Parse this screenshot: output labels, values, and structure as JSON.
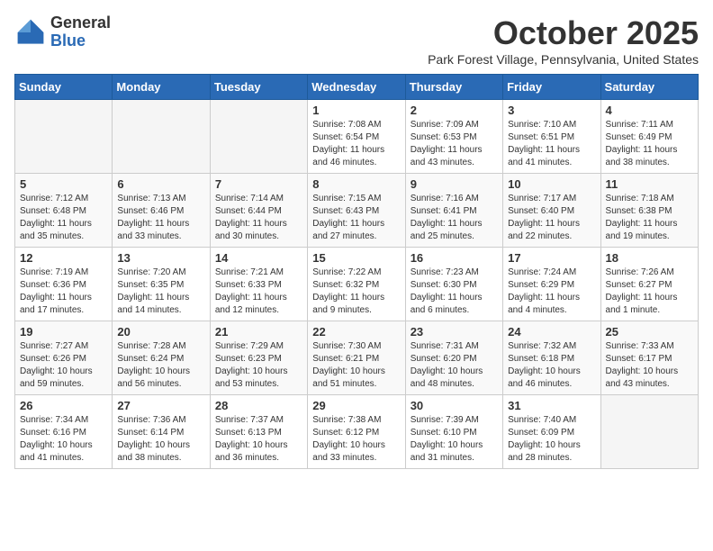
{
  "header": {
    "logo_general": "General",
    "logo_blue": "Blue",
    "month_title": "October 2025",
    "location": "Park Forest Village, Pennsylvania, United States"
  },
  "days_of_week": [
    "Sunday",
    "Monday",
    "Tuesday",
    "Wednesday",
    "Thursday",
    "Friday",
    "Saturday"
  ],
  "weeks": [
    [
      {
        "day": "",
        "info": ""
      },
      {
        "day": "",
        "info": ""
      },
      {
        "day": "",
        "info": ""
      },
      {
        "day": "1",
        "info": "Sunrise: 7:08 AM\nSunset: 6:54 PM\nDaylight: 11 hours and 46 minutes."
      },
      {
        "day": "2",
        "info": "Sunrise: 7:09 AM\nSunset: 6:53 PM\nDaylight: 11 hours and 43 minutes."
      },
      {
        "day": "3",
        "info": "Sunrise: 7:10 AM\nSunset: 6:51 PM\nDaylight: 11 hours and 41 minutes."
      },
      {
        "day": "4",
        "info": "Sunrise: 7:11 AM\nSunset: 6:49 PM\nDaylight: 11 hours and 38 minutes."
      }
    ],
    [
      {
        "day": "5",
        "info": "Sunrise: 7:12 AM\nSunset: 6:48 PM\nDaylight: 11 hours and 35 minutes."
      },
      {
        "day": "6",
        "info": "Sunrise: 7:13 AM\nSunset: 6:46 PM\nDaylight: 11 hours and 33 minutes."
      },
      {
        "day": "7",
        "info": "Sunrise: 7:14 AM\nSunset: 6:44 PM\nDaylight: 11 hours and 30 minutes."
      },
      {
        "day": "8",
        "info": "Sunrise: 7:15 AM\nSunset: 6:43 PM\nDaylight: 11 hours and 27 minutes."
      },
      {
        "day": "9",
        "info": "Sunrise: 7:16 AM\nSunset: 6:41 PM\nDaylight: 11 hours and 25 minutes."
      },
      {
        "day": "10",
        "info": "Sunrise: 7:17 AM\nSunset: 6:40 PM\nDaylight: 11 hours and 22 minutes."
      },
      {
        "day": "11",
        "info": "Sunrise: 7:18 AM\nSunset: 6:38 PM\nDaylight: 11 hours and 19 minutes."
      }
    ],
    [
      {
        "day": "12",
        "info": "Sunrise: 7:19 AM\nSunset: 6:36 PM\nDaylight: 11 hours and 17 minutes."
      },
      {
        "day": "13",
        "info": "Sunrise: 7:20 AM\nSunset: 6:35 PM\nDaylight: 11 hours and 14 minutes."
      },
      {
        "day": "14",
        "info": "Sunrise: 7:21 AM\nSunset: 6:33 PM\nDaylight: 11 hours and 12 minutes."
      },
      {
        "day": "15",
        "info": "Sunrise: 7:22 AM\nSunset: 6:32 PM\nDaylight: 11 hours and 9 minutes."
      },
      {
        "day": "16",
        "info": "Sunrise: 7:23 AM\nSunset: 6:30 PM\nDaylight: 11 hours and 6 minutes."
      },
      {
        "day": "17",
        "info": "Sunrise: 7:24 AM\nSunset: 6:29 PM\nDaylight: 11 hours and 4 minutes."
      },
      {
        "day": "18",
        "info": "Sunrise: 7:26 AM\nSunset: 6:27 PM\nDaylight: 11 hours and 1 minute."
      }
    ],
    [
      {
        "day": "19",
        "info": "Sunrise: 7:27 AM\nSunset: 6:26 PM\nDaylight: 10 hours and 59 minutes."
      },
      {
        "day": "20",
        "info": "Sunrise: 7:28 AM\nSunset: 6:24 PM\nDaylight: 10 hours and 56 minutes."
      },
      {
        "day": "21",
        "info": "Sunrise: 7:29 AM\nSunset: 6:23 PM\nDaylight: 10 hours and 53 minutes."
      },
      {
        "day": "22",
        "info": "Sunrise: 7:30 AM\nSunset: 6:21 PM\nDaylight: 10 hours and 51 minutes."
      },
      {
        "day": "23",
        "info": "Sunrise: 7:31 AM\nSunset: 6:20 PM\nDaylight: 10 hours and 48 minutes."
      },
      {
        "day": "24",
        "info": "Sunrise: 7:32 AM\nSunset: 6:18 PM\nDaylight: 10 hours and 46 minutes."
      },
      {
        "day": "25",
        "info": "Sunrise: 7:33 AM\nSunset: 6:17 PM\nDaylight: 10 hours and 43 minutes."
      }
    ],
    [
      {
        "day": "26",
        "info": "Sunrise: 7:34 AM\nSunset: 6:16 PM\nDaylight: 10 hours and 41 minutes."
      },
      {
        "day": "27",
        "info": "Sunrise: 7:36 AM\nSunset: 6:14 PM\nDaylight: 10 hours and 38 minutes."
      },
      {
        "day": "28",
        "info": "Sunrise: 7:37 AM\nSunset: 6:13 PM\nDaylight: 10 hours and 36 minutes."
      },
      {
        "day": "29",
        "info": "Sunrise: 7:38 AM\nSunset: 6:12 PM\nDaylight: 10 hours and 33 minutes."
      },
      {
        "day": "30",
        "info": "Sunrise: 7:39 AM\nSunset: 6:10 PM\nDaylight: 10 hours and 31 minutes."
      },
      {
        "day": "31",
        "info": "Sunrise: 7:40 AM\nSunset: 6:09 PM\nDaylight: 10 hours and 28 minutes."
      },
      {
        "day": "",
        "info": ""
      }
    ]
  ]
}
